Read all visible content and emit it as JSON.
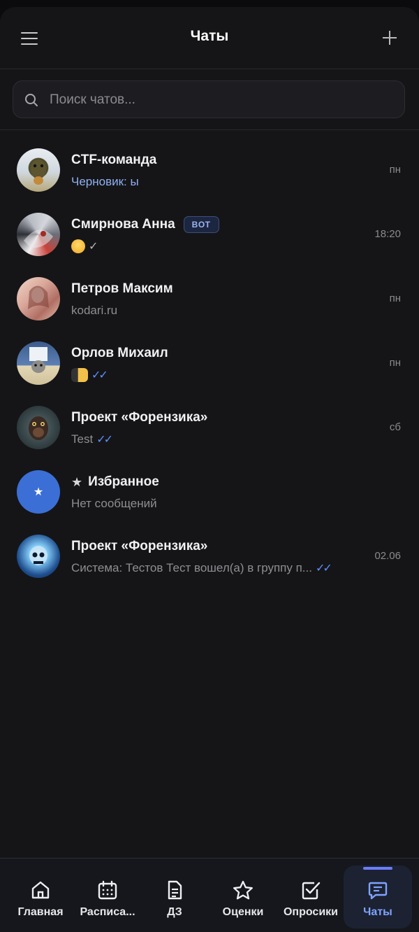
{
  "header": {
    "title": "Чаты"
  },
  "search": {
    "placeholder": "Поиск чатов..."
  },
  "chats": [
    {
      "name": "CTF-команда",
      "message": "Черновик: ы",
      "time": "пн",
      "draft": true
    },
    {
      "name": "Смирнова Анна",
      "badge": "BOT",
      "message": "",
      "time": "18:20",
      "emoji": "face-emoji",
      "status": "✓"
    },
    {
      "name": "Петров Максим",
      "message": "kodari.ru",
      "time": "пн"
    },
    {
      "name": "Орлов Михаил",
      "message": "",
      "time": "пн",
      "emoji": "gesture-emoji",
      "status": "✓✓"
    },
    {
      "name": "Проект «Форензика»",
      "message": "Test",
      "time": "сб",
      "status": "✓✓"
    },
    {
      "name": "Избранное",
      "prefix": "★",
      "message": "Нет сообщений",
      "time": ""
    },
    {
      "name": "Проект «Форензика»",
      "message": "Система: Тестов Тест вошел(а) в группу п...",
      "time": "02.06",
      "status": "✓✓"
    }
  ],
  "nav": [
    {
      "label": "Главная",
      "icon": "home-icon"
    },
    {
      "label": "Расписа...",
      "icon": "calendar-icon"
    },
    {
      "label": "ДЗ",
      "icon": "document-icon"
    },
    {
      "label": "Оценки",
      "icon": "star-icon"
    },
    {
      "label": "Опросики",
      "icon": "checkbox-icon"
    },
    {
      "label": "Чаты",
      "icon": "chat-icon",
      "active": true
    }
  ],
  "colors": {
    "accent": "#5d8fff",
    "draft": "#8fb0f2",
    "favorites": "#3b6fd6",
    "background": "#151517"
  }
}
